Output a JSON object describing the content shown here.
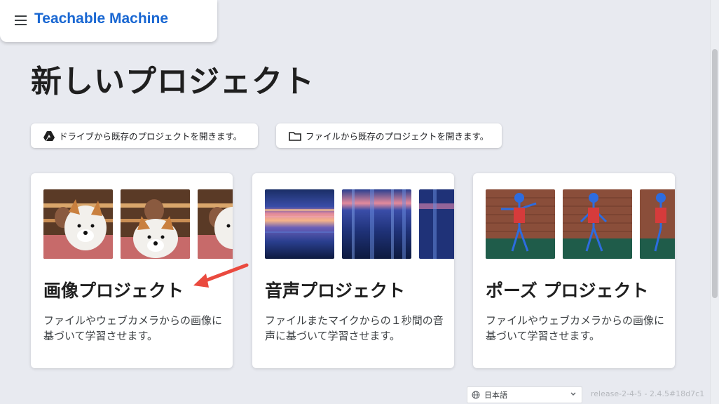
{
  "header": {
    "menu_icon": "hamburger-menu-icon",
    "app_title": "Teachable Machine"
  },
  "page": {
    "title": "新しいプロジェクト"
  },
  "open_buttons": {
    "drive": {
      "label": "ドライブから既存のプロジェクトを開きます。",
      "icon": "google-drive-icon"
    },
    "file": {
      "label": "ファイルから既存のプロジェクトを開きます。",
      "icon": "folder-icon"
    }
  },
  "cards": [
    {
      "title": "画像プロジェクト",
      "description": "ファイルやウェブカメラからの画像に基づいて学習させます。"
    },
    {
      "title": "音声プロジェクト",
      "description": "ファイルまたマイクからの１秒間の音声に基づいて学習させます。"
    },
    {
      "title": "ポーズ プロジェクト",
      "description": "ファイルやウェブカメラからの画像に基づいて学習させます。"
    }
  ],
  "footer": {
    "language": "日本語",
    "release": "release-2-4-5 - 2.4.5#18d7c1"
  },
  "colors": {
    "accent": "#1967d2",
    "background": "#e8eaf0",
    "annotation_arrow": "#ea4a3f"
  }
}
